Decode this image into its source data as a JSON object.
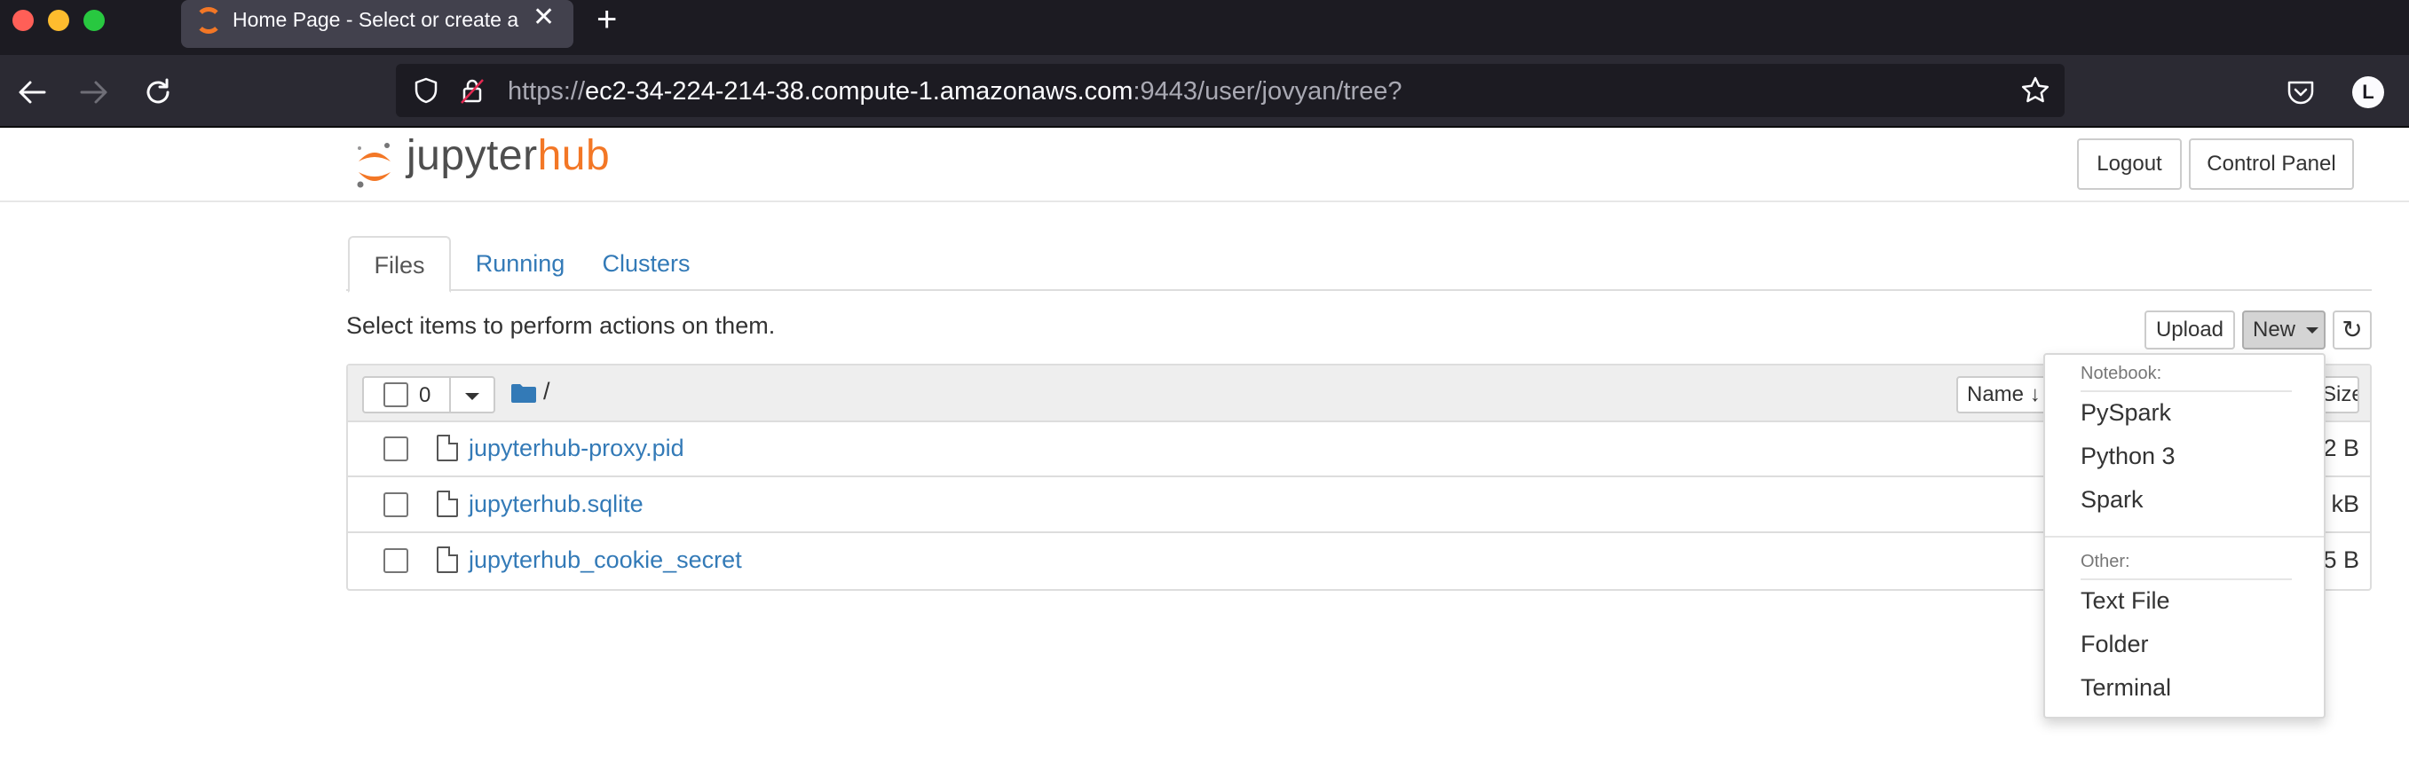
{
  "browser": {
    "tab_title": "Home Page - Select or create a notebook",
    "tab_close": "✕",
    "new_tab": "+",
    "url_scheme": "https://",
    "url_host": "ec2-34-224-214-38.compute-1.amazonaws.com",
    "url_rest": ":9443/user/jovyan/tree?",
    "profile_initial": "L",
    "accent": "#f37726"
  },
  "header": {
    "logo_text_a": "jupyter",
    "logo_text_b": "hub",
    "logout_label": "Logout",
    "control_panel_label": "Control Panel"
  },
  "tabs": [
    {
      "label": "Files"
    },
    {
      "label": "Running"
    },
    {
      "label": "Clusters"
    }
  ],
  "toolbar": {
    "instructions": "Select items to perform actions on them.",
    "upload_label": "Upload",
    "new_label": "New",
    "refresh_icon": "↻"
  },
  "list_header": {
    "selected_count": "0",
    "path": "/",
    "name_sort_label": "Name",
    "size_label": "Size"
  },
  "files": [
    {
      "name": "jupyterhub-proxy.pid",
      "size": "2 B"
    },
    {
      "name": "jupyterhub.sqlite",
      "size": "kB"
    },
    {
      "name": "jupyterhub_cookie_secret",
      "size": "5 B"
    }
  ],
  "new_menu": {
    "notebook_header": "Notebook:",
    "notebook_items": [
      "PySpark",
      "Python 3",
      "Spark"
    ],
    "other_header": "Other:",
    "other_items": [
      "Text File",
      "Folder",
      "Terminal"
    ]
  }
}
